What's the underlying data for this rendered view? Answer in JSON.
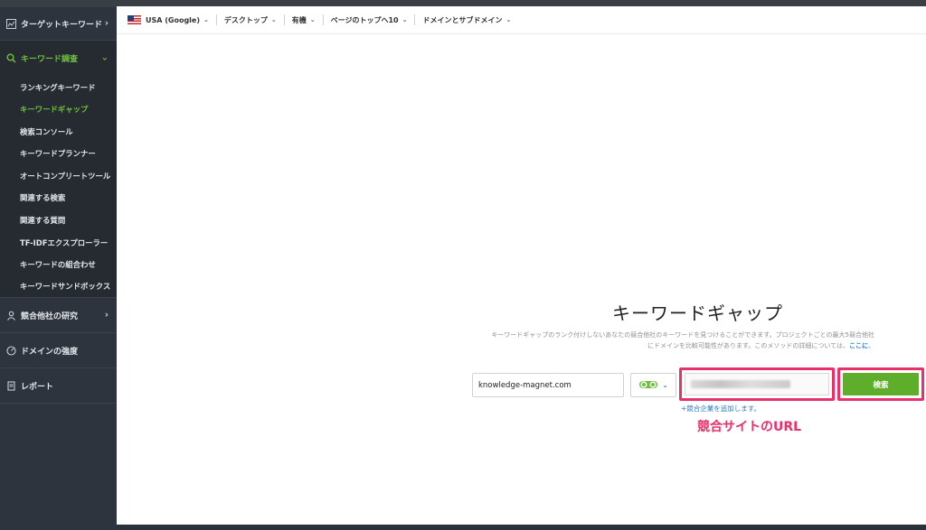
{
  "sidebar": {
    "sections": {
      "target_keywords": "ターゲットキーワード",
      "keyword_research": "キーワード調査",
      "competitor_research": "競合他社の研究",
      "domain_strength": "ドメインの強度",
      "report": "レポート"
    },
    "sub_items": [
      "ランキングキーワード",
      "キーワードギャップ",
      "検索コンソール",
      "キーワードプランナー",
      "オートコンプリートツール",
      "関連する検索",
      "関連する質問",
      "TF-IDFエクスプローラー",
      "キーワードの組合わせ",
      "キーワードサンドボックス"
    ],
    "active_index": 1
  },
  "topbar": {
    "location": "USA (Google)",
    "device": "デスクトップ",
    "type": "有機",
    "top": "ページのトップへ10",
    "scope": "ドメインとサブドメイン"
  },
  "main": {
    "title": "キーワードギャップ",
    "description": "キーワードギャップのランク付けしないあなたの競合他社のキーワードを見つけることができます。プロジェクトごとの最大5競合他社にドメインを比較可能性があります。このメソッドの詳細については、",
    "description_link": "ここに",
    "description_end": "。",
    "domain_value": "knowledge-magnet.com",
    "search_button": "検索",
    "add_competitor": "+競合企業を追加します。",
    "annotation": "競合サイトのURL"
  },
  "colors": {
    "accent_green": "#5fae2b",
    "highlight_pink": "#e8306a",
    "link_blue": "#2a7ac0"
  }
}
